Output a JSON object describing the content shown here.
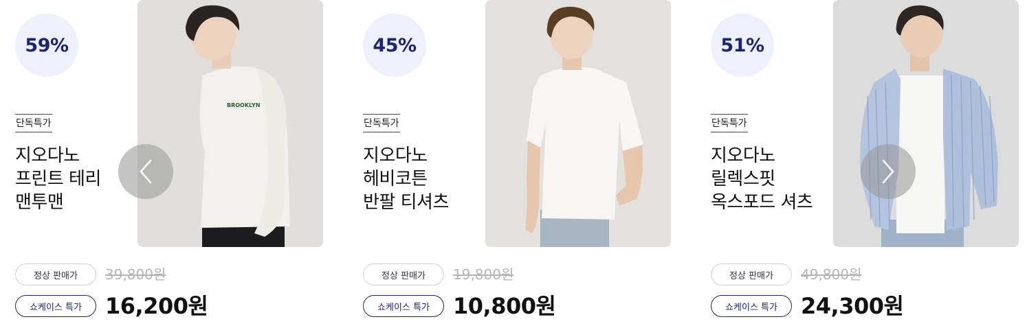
{
  "products": [
    {
      "discount": "59%",
      "tag": "단독특가",
      "name_lines": [
        "지오다노",
        "프린트 테리",
        "맨투맨"
      ],
      "regular_label": "정상 판매가",
      "regular_price": "39,800원",
      "special_label": "쇼케이스 특가",
      "special_price": "16,200원",
      "image": "model-sweatshirt"
    },
    {
      "discount": "45%",
      "tag": "단독특가",
      "name_lines": [
        "지오다노",
        "헤비코튼",
        "반팔 티셔츠"
      ],
      "regular_label": "정상 판매가",
      "regular_price": "19,800원",
      "special_label": "쇼케이스 특가",
      "special_price": "10,800원",
      "image": "model-tshirt"
    },
    {
      "discount": "51%",
      "tag": "단독특가",
      "name_lines": [
        "지오다노",
        "릴렉스핏",
        "옥스포드 셔츠"
      ],
      "regular_label": "정상 판매가",
      "regular_price": "49,800원",
      "special_label": "쇼케이스 특가",
      "special_price": "24,300원",
      "image": "model-oxford-shirt"
    }
  ],
  "sweatshirt_print": "BROOKLYN",
  "icons": {
    "prev": "chevron-left-icon",
    "next": "chevron-right-icon"
  },
  "colors": {
    "accent": "#1b2570",
    "badge_bg": "#eef0fb",
    "strike": "#b5b5b5"
  }
}
